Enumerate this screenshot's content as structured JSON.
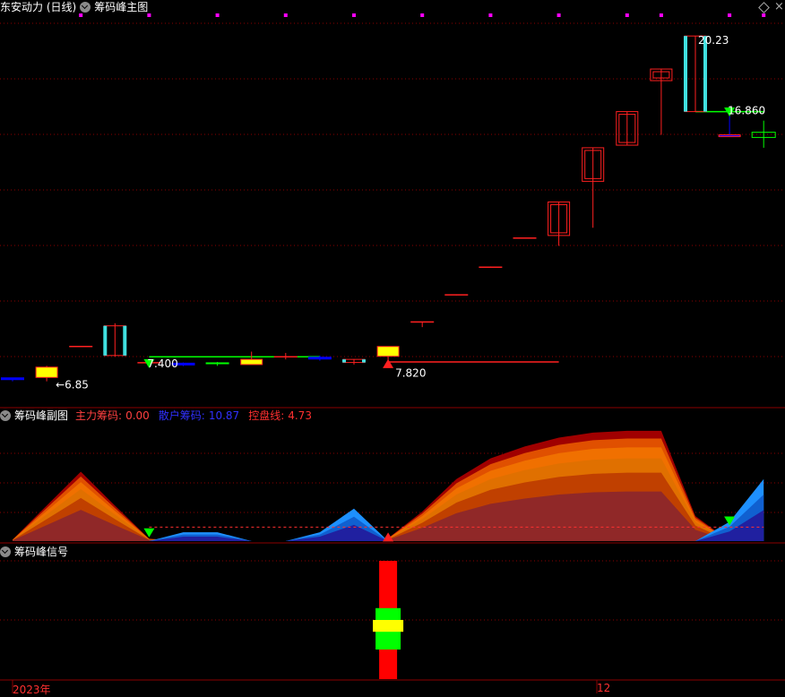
{
  "colors": {
    "bg": "#000000",
    "grid": "#8b0000",
    "up": "#ff2020",
    "down_fill": "#0000ff",
    "cyan": "#40e0e0",
    "yellow": "#ffff00",
    "green": "#00ff00",
    "magenta": "#ff00ff",
    "label": "#ffffff",
    "zhuli": "#ff4040",
    "sanhu": "#3030ff",
    "kongpan": "#ff3030"
  },
  "main_panel": {
    "stock_title": "东安动力 (日线)",
    "indicator_title": "筹码峰主图",
    "icons": [
      "chevron-down-icon",
      "diamond-icon",
      "close-icon"
    ]
  },
  "sub_panel": {
    "title": "筹码峰副图",
    "zhuli_label": "主力筹码:",
    "zhuli_value": "0.00",
    "sanhu_label": "散户筹码:",
    "sanhu_value": "10.87",
    "kongpan_label": "控盘线:",
    "kongpan_value": "4.73"
  },
  "signal_panel": {
    "title": "筹码峰信号"
  },
  "x_axis": {
    "start_label": "2023年",
    "mid_label": "12"
  },
  "chart_data": {
    "type": "candlestick",
    "price_range": [
      5.9,
      21.0
    ],
    "candles": [
      {
        "o": 6.95,
        "h": 6.98,
        "l": 6.85,
        "c": 6.92,
        "style": "blue-dash"
      },
      {
        "o": 7.0,
        "h": 7.45,
        "l": 6.85,
        "c": 7.4,
        "style": "yellow"
      },
      {
        "o": 8.2,
        "h": 8.22,
        "l": 8.18,
        "c": 8.2,
        "style": "dash"
      },
      {
        "o": 7.85,
        "h": 9.1,
        "l": 7.8,
        "c": 9.0,
        "style": "cyan"
      },
      {
        "o": 7.57,
        "h": 7.62,
        "l": 7.5,
        "c": 7.55,
        "style": "small"
      },
      {
        "o": 7.5,
        "h": 7.58,
        "l": 7.44,
        "c": 7.52,
        "style": "blue-dash"
      },
      {
        "o": 7.52,
        "h": 7.6,
        "l": 7.45,
        "c": 7.55,
        "style": "green-dash"
      },
      {
        "o": 7.5,
        "h": 8.0,
        "l": 7.5,
        "c": 7.7,
        "style": "yellow"
      },
      {
        "o": 7.78,
        "h": 7.95,
        "l": 7.7,
        "c": 7.8,
        "style": "dash"
      },
      {
        "o": 7.72,
        "h": 7.85,
        "l": 7.65,
        "c": 7.75,
        "style": "blue-dash"
      },
      {
        "o": 7.58,
        "h": 7.7,
        "l": 7.5,
        "c": 7.7,
        "style": "cyan"
      },
      {
        "o": 7.82,
        "h": 8.2,
        "l": 7.55,
        "c": 8.2,
        "style": "yellow"
      },
      {
        "o": 9.15,
        "h": 9.16,
        "l": 8.95,
        "c": 9.15,
        "style": "dash"
      },
      {
        "o": 10.2,
        "h": 10.22,
        "l": 10.18,
        "c": 10.2,
        "style": "dash"
      },
      {
        "o": 11.27,
        "h": 11.3,
        "l": 11.25,
        "c": 11.27,
        "style": "dash"
      },
      {
        "o": 12.4,
        "h": 12.42,
        "l": 12.38,
        "c": 12.4,
        "style": "dash"
      },
      {
        "o": 12.5,
        "h": 13.8,
        "l": 12.1,
        "c": 13.8,
        "style": "up"
      },
      {
        "o": 14.6,
        "h": 15.9,
        "l": 12.8,
        "c": 15.9,
        "style": "up"
      },
      {
        "o": 16.0,
        "h": 17.3,
        "l": 16.0,
        "c": 17.3,
        "style": "up"
      },
      {
        "o": 18.5,
        "h": 18.95,
        "l": 16.4,
        "c": 18.95,
        "style": "up"
      },
      {
        "o": 17.3,
        "h": 20.23,
        "l": 17.3,
        "c": 20.23,
        "style": "cyan"
      },
      {
        "o": 16.4,
        "h": 17.3,
        "l": 16.4,
        "c": 16.4,
        "style": "blue"
      },
      {
        "o": 16.3,
        "h": 16.95,
        "l": 15.9,
        "c": 16.5,
        "style": "green-cross"
      }
    ],
    "annotations": [
      {
        "text": "←6.85",
        "color": "#ffffff"
      },
      {
        "text": "7.400",
        "color": "#ffffff"
      },
      {
        "text": "7.820",
        "color": "#ffffff"
      },
      {
        "text": "16.860",
        "color": "#ffffff"
      },
      {
        "text": "20.23",
        "color": "#ffffff"
      }
    ],
    "support_lines": [
      {
        "price": 7.8,
        "from": 4,
        "to": 9,
        "color": "#00ff00"
      },
      {
        "price": 7.6,
        "from": 11,
        "to": 16,
        "color": "#ff2020"
      },
      {
        "price": 17.3,
        "from": 20,
        "to": 22,
        "color": "#00ff00"
      }
    ],
    "arrows": [
      {
        "candle": 4,
        "price": 7.5,
        "dir": "down",
        "color": "#00ff00"
      },
      {
        "candle": 11,
        "price": 7.57,
        "dir": "up",
        "color": "#ff2020"
      },
      {
        "candle": 21,
        "price": 17.25,
        "dir": "down",
        "color": "#00ff00"
      }
    ],
    "top_markers": [
      2,
      4,
      6,
      8,
      10,
      12,
      14,
      16,
      18,
      19,
      21,
      22
    ],
    "sub_chart": {
      "range": [
        0,
        40
      ],
      "kongpan": 4.73,
      "zhuli": [
        0.5,
        12,
        23.5,
        12,
        0.8,
        0,
        0,
        0,
        0,
        0,
        0,
        1,
        10,
        21,
        28,
        32,
        35,
        36.7,
        37.3,
        37.3,
        8.5,
        0,
        0
      ],
      "sanhu": [
        0,
        0,
        0,
        0,
        0,
        3,
        3,
        0,
        0,
        3,
        11,
        0,
        0,
        0,
        0,
        0,
        0,
        0,
        0,
        0,
        0,
        6.5,
        21
      ]
    },
    "signal": {
      "candle": 11,
      "red": [
        0,
        1
      ],
      "green": [
        0.25,
        0.6
      ],
      "yellow": [
        0.4,
        0.5
      ]
    }
  }
}
